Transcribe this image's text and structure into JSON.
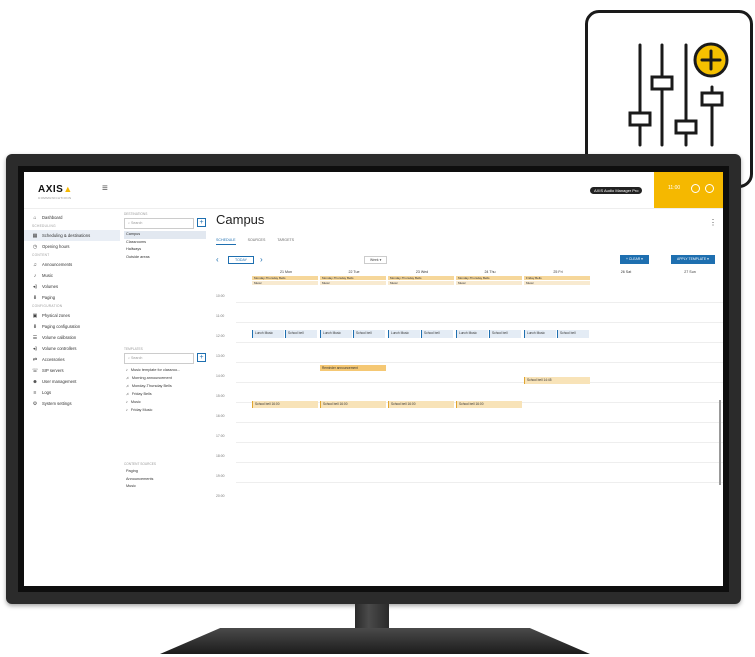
{
  "app": {
    "logo_text": "AXIS",
    "logo_sub": "COMMUNICATIONS",
    "badge_label": "AXIS Audio Manager Pro",
    "time": "11:00"
  },
  "sidebar": {
    "sections": [
      {
        "header": "",
        "items": [
          {
            "label": "Dashboard",
            "icon": "home-icon"
          }
        ]
      },
      {
        "header": "SCHEDULING",
        "items": [
          {
            "label": "Scheduling & destinations",
            "icon": "calendar-icon",
            "active": true
          },
          {
            "label": "Opening hours",
            "icon": "clock-icon"
          }
        ]
      },
      {
        "header": "CONTENT",
        "items": [
          {
            "label": "Announcements",
            "icon": "announcement-icon"
          },
          {
            "label": "Music",
            "icon": "music-icon"
          },
          {
            "label": "Volumes",
            "icon": "volume-icon"
          },
          {
            "label": "Paging",
            "icon": "paging-icon"
          }
        ]
      },
      {
        "header": "CONFIGURATION",
        "items": [
          {
            "label": "Physical zones",
            "icon": "zones-icon"
          },
          {
            "label": "Paging configuration",
            "icon": "paging-config-icon"
          },
          {
            "label": "Volume calibration",
            "icon": "calibration-icon"
          },
          {
            "label": "Volume controllers",
            "icon": "controllers-icon"
          },
          {
            "label": "Accessories",
            "icon": "accessories-icon"
          },
          {
            "label": "SIP servers",
            "icon": "sip-icon"
          },
          {
            "label": "User management",
            "icon": "users-icon"
          },
          {
            "label": "Logs",
            "icon": "logs-icon"
          },
          {
            "label": "System settings",
            "icon": "gear-icon"
          }
        ]
      }
    ]
  },
  "destinations": {
    "header": "DESTINATIONS",
    "search_placeholder": "Search",
    "items": [
      "Campus",
      "Classrooms",
      "Hallways",
      "Outside areas"
    ]
  },
  "templates": {
    "header": "TEMPLATES",
    "search_placeholder": "Search",
    "items": [
      {
        "label": "Music template for classroo...",
        "icon": "music-icon"
      },
      {
        "label": "Morning announcement",
        "icon": "announcement-icon"
      },
      {
        "label": "Monday-Thursday Bells",
        "icon": "announcement-icon"
      },
      {
        "label": "Friday Bells",
        "icon": "announcement-icon"
      },
      {
        "label": "Music",
        "icon": "music-icon"
      },
      {
        "label": "Friday Music",
        "icon": "music-icon"
      }
    ]
  },
  "content_sources": {
    "header": "CONTENT SOURCES",
    "items": [
      "Paging",
      "Announcements",
      "Music"
    ]
  },
  "main": {
    "title": "Campus",
    "tabs": [
      "SCHEDULE",
      "SOURCES",
      "TARGETS"
    ],
    "today_label": "TODAY",
    "view_label": "Week",
    "create_label": "+ CLEAR",
    "apply_label": "APPLY TEMPLATE"
  },
  "calendar": {
    "days": [
      {
        "label": "21 Mon",
        "bars": [
          "Monday-Thursday Bells",
          "Music"
        ]
      },
      {
        "label": "22 Tue",
        "bars": [
          "Monday-Thursday Bells",
          "Music"
        ]
      },
      {
        "label": "23 Wed",
        "bars": [
          "Monday-Thursday Bells",
          "Music"
        ]
      },
      {
        "label": "24 Thu",
        "bars": [
          "Monday-Thursday Bells",
          "Music"
        ]
      },
      {
        "label": "25 Fri",
        "bars": [
          "Friday Bells",
          "Music"
        ]
      },
      {
        "label": "26 Sat",
        "bars": []
      },
      {
        "label": "27 Sun",
        "bars": []
      }
    ],
    "hours": [
      "10:00",
      "11:00",
      "12:00",
      "13:00",
      "14:00",
      "15:00",
      "16:00",
      "17:00",
      "18:00",
      "19:00",
      "20:00"
    ],
    "lunch_music": "Lunch Music",
    "school_bell": "School bell",
    "school_bell_time": "16:00",
    "school_bell_fri": "School bell",
    "school_bell_fri_time": "14:45",
    "reminder": "Reminder announcement"
  }
}
